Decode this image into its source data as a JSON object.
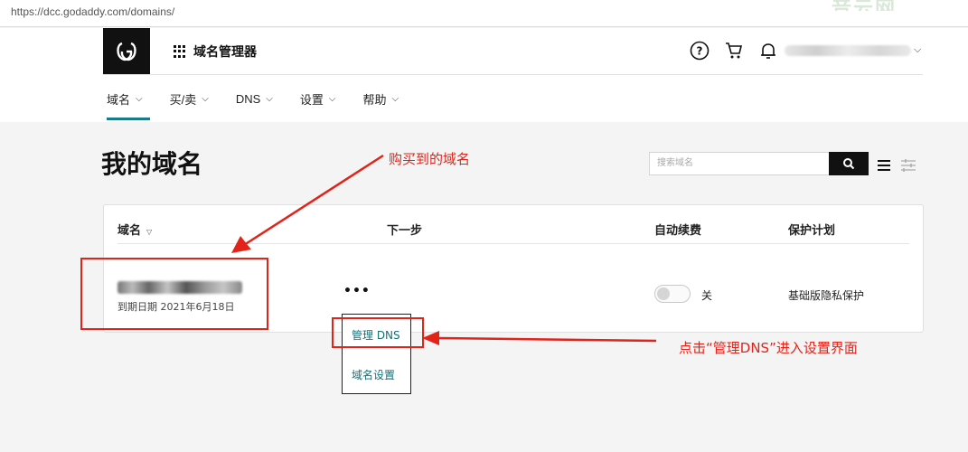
{
  "browser": {
    "url": "https://dcc.godaddy.com/domains/",
    "watermark": "音云网"
  },
  "header": {
    "app_title": "域名管理器",
    "icons": [
      "help-icon",
      "cart-icon",
      "bell-icon"
    ],
    "tabs": [
      {
        "label": "域名"
      },
      {
        "label": "买/卖"
      },
      {
        "label": "DNS"
      },
      {
        "label": "设置"
      },
      {
        "label": "帮助"
      }
    ]
  },
  "main": {
    "title": "我的域名",
    "search_placeholder": "搜索域名"
  },
  "table": {
    "columns": {
      "domain": "域名",
      "next_step": "下一步",
      "auto_renew": "自动续费",
      "protection": "保护计划"
    },
    "row": {
      "expiry": "到期日期 2021年6月18日",
      "more": "•••",
      "auto_renew_state": "关",
      "protection": "基础版隐私保护"
    }
  },
  "dropdown": {
    "items": [
      "管理 DNS",
      "域名设置"
    ]
  },
  "annotations": {
    "purchased_domain": "购买到的域名",
    "click_manage_dns": "点击“管理DNS”进入设置界面"
  },
  "colors": {
    "accent": "#1a7a8a",
    "annotation": "#e2231a",
    "link": "#137078"
  }
}
